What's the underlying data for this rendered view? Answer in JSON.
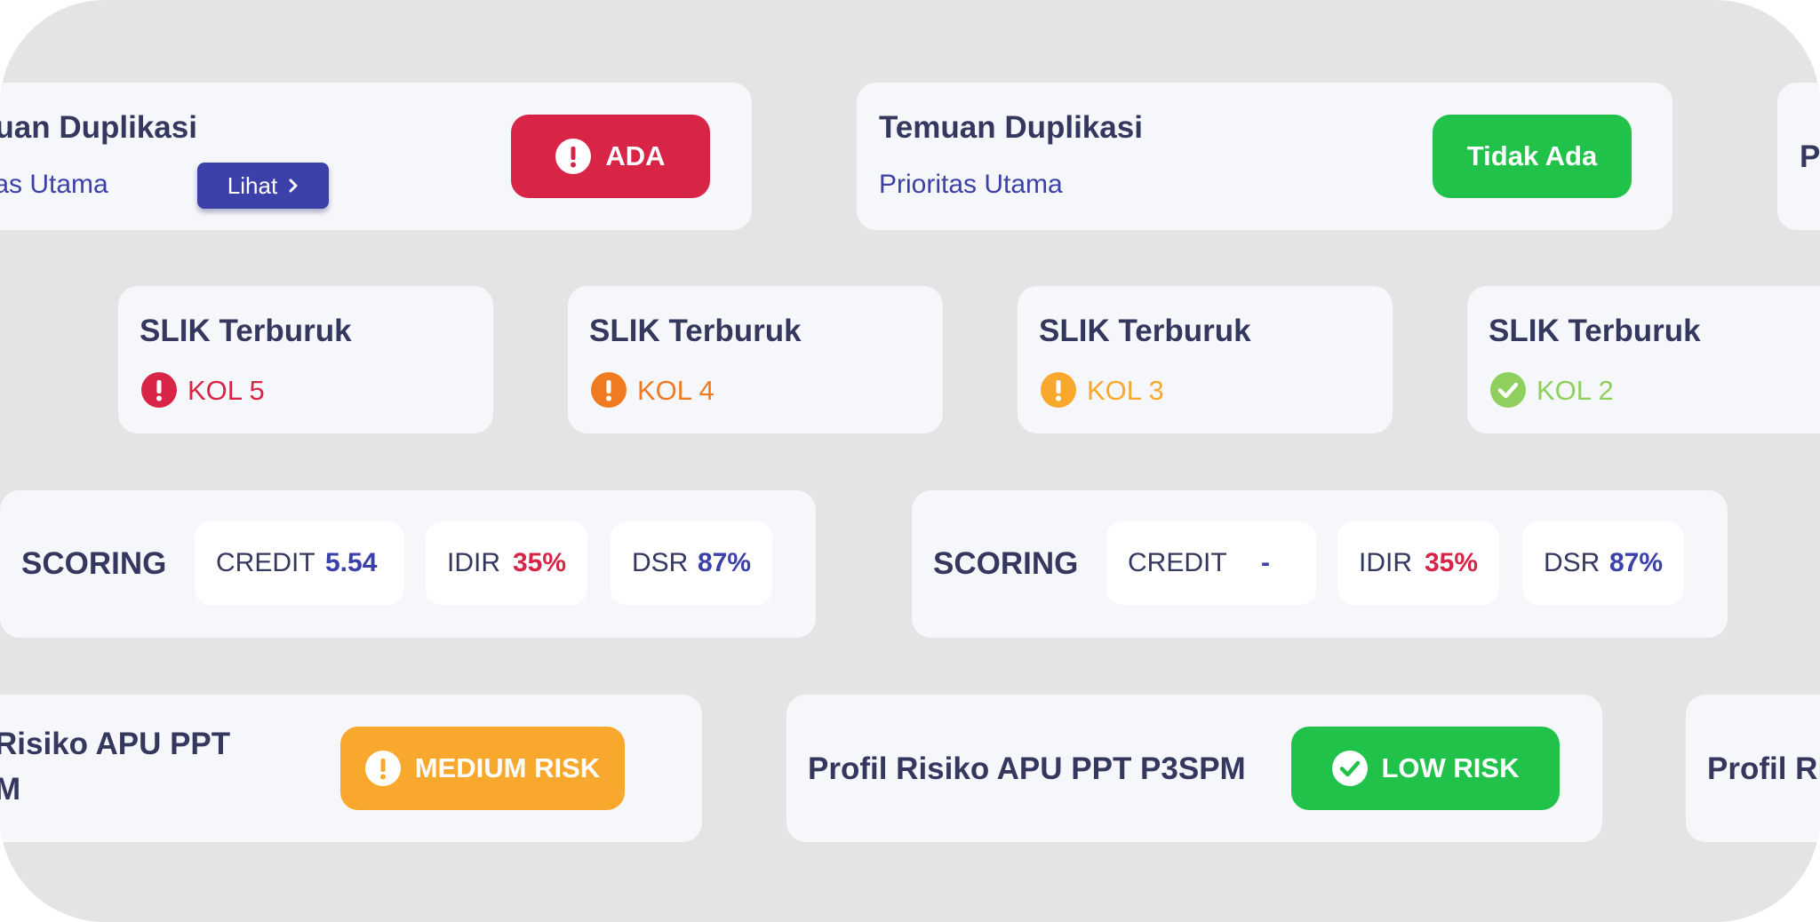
{
  "colors": {
    "canvas": "#e3e4e3",
    "card": "#f6f7fa",
    "title": "#35385e",
    "blue": "#3b41a8",
    "red": "#d72447",
    "green": "#21c24a",
    "orange": "#f07a20",
    "amber": "#f9a82e",
    "light_green": "#8fcf5d"
  },
  "duplikasi": [
    {
      "title": "Temuan Duplikasi",
      "subtitle": "Prioritas Utama",
      "link_label": "Lihat",
      "badge_label": "ADA",
      "badge_icon": "exclamation-icon"
    },
    {
      "title": "Temuan Duplikasi",
      "subtitle": "Prioritas Utama",
      "badge_label": "Tidak Ada"
    },
    {
      "title": "P"
    }
  ],
  "slik": [
    {
      "title": "SLIK Terburuk",
      "label": "KOL 5",
      "icon": "exclamation-icon"
    },
    {
      "title": "SLIK Terburuk",
      "label": "KOL 4",
      "icon": "exclamation-icon"
    },
    {
      "title": "SLIK Terburuk",
      "label": "KOL 3",
      "icon": "exclamation-icon"
    },
    {
      "title": "SLIK Terburuk",
      "label": "KOL 2",
      "icon": "check-icon"
    }
  ],
  "scoring": [
    {
      "label": "SCORING",
      "credit_label": "CREDIT",
      "credit_value": "5.54",
      "idir_label": "IDIR",
      "idir_value": "35%",
      "dsr_label": "DSR",
      "dsr_value": "87%"
    },
    {
      "label": "SCORING",
      "credit_label": "CREDIT",
      "credit_value": "-",
      "idir_label": "IDIR",
      "idir_value": "35%",
      "dsr_label": "DSR",
      "dsr_value": "87%"
    }
  ],
  "apu": [
    {
      "title_line1": "Risiko APU PPT",
      "title_line2": "M",
      "badge_label": "MEDIUM RISK",
      "badge_icon": "exclamation-icon"
    },
    {
      "title": "Profil Risiko APU PPT P3SPM",
      "badge_label": "LOW RISK",
      "badge_icon": "check-icon"
    },
    {
      "title": "Profil Ri"
    }
  ]
}
